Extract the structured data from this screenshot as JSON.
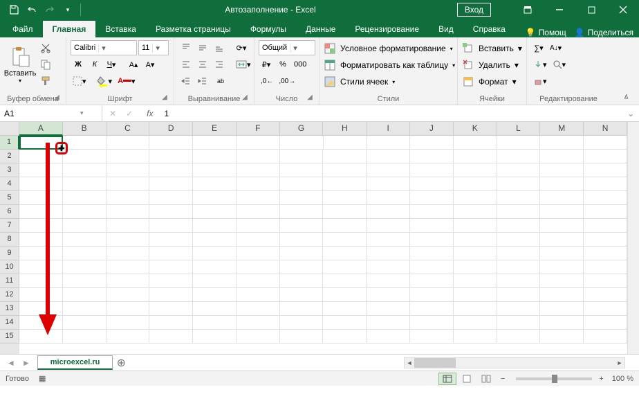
{
  "title": "Автозаполнение  -  Excel",
  "login": "Вход",
  "tabs": [
    "Файл",
    "Главная",
    "Вставка",
    "Разметка страницы",
    "Формулы",
    "Данные",
    "Рецензирование",
    "Вид",
    "Справка"
  ],
  "active_tab": 1,
  "help_label": "Помощ",
  "share_label": "Поделиться",
  "ribbon": {
    "clipboard": {
      "paste": "Вставить",
      "label": "Буфер обмена"
    },
    "font": {
      "name": "Calibri",
      "size": "11",
      "label": "Шрифт",
      "bold": "Ж",
      "italic": "К",
      "underline": "Ч"
    },
    "align": {
      "label": "Выравнивание"
    },
    "number": {
      "format": "Общий",
      "label": "Число"
    },
    "styles": {
      "cond": "Условное форматирование",
      "table": "Форматировать как таблицу",
      "cell": "Стили ячеек",
      "label": "Стили"
    },
    "cells": {
      "insert": "Вставить",
      "delete": "Удалить",
      "format": "Формат",
      "label": "Ячейки"
    },
    "editing": {
      "label": "Редактирование"
    }
  },
  "namebox": "A1",
  "formula": "1",
  "columns": [
    "A",
    "B",
    "C",
    "D",
    "E",
    "F",
    "G",
    "H",
    "I",
    "J",
    "K",
    "L",
    "M",
    "N"
  ],
  "rows": [
    "1",
    "2",
    "3",
    "4",
    "5",
    "6",
    "7",
    "8",
    "9",
    "10",
    "11",
    "12",
    "13",
    "14",
    "15"
  ],
  "sheet_tab": "microexcel.ru",
  "status": "Готово",
  "zoom_minus": "−",
  "zoom_plus": "+",
  "zoom": "100 %"
}
